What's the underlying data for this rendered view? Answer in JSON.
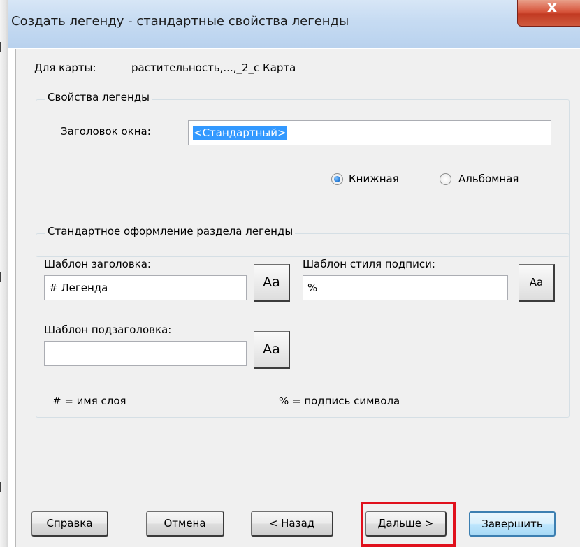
{
  "window": {
    "title": "Создать легенду - стандартные свойства легенды",
    "close_glyph": "x"
  },
  "map_line": {
    "label": "Для карты:",
    "value": "растительность,...,_2_с Карта"
  },
  "legend_properties": {
    "group_title": "Свойства легенды",
    "window_title_label": "Заголовок окна:",
    "window_title_value": "<Стандартный>",
    "orientation": {
      "portrait_label": "Книжная",
      "landscape_label": "Альбомная",
      "selected": "portrait"
    }
  },
  "section_style": {
    "group_title": "Стандартное оформление раздела легенды",
    "title_template_label": "Шаблон заголовка:",
    "title_template_value": "# Легенда",
    "label_style_template_label": "Шаблон стиля подписи:",
    "label_style_template_value": "%",
    "subtitle_template_label": "Шаблон подзаголовка:",
    "subtitle_template_value": "",
    "font_button_label": "Аа",
    "hint_layer": "# = имя слоя",
    "hint_symbol": "% = подпись символа"
  },
  "buttons": {
    "help": "Справка",
    "cancel": "Отмена",
    "back": "< Назад",
    "next": "Дальше >",
    "finish": "Завершить"
  },
  "colors": {
    "highlight": "#e0101c",
    "selection": "#3399ff",
    "titlebar": "#c6dbf2",
    "close_button": "#c94a32"
  },
  "icons": {
    "close": "close-icon",
    "radio_checked": "radio-checked-icon",
    "radio_unchecked": "radio-unchecked-icon"
  }
}
